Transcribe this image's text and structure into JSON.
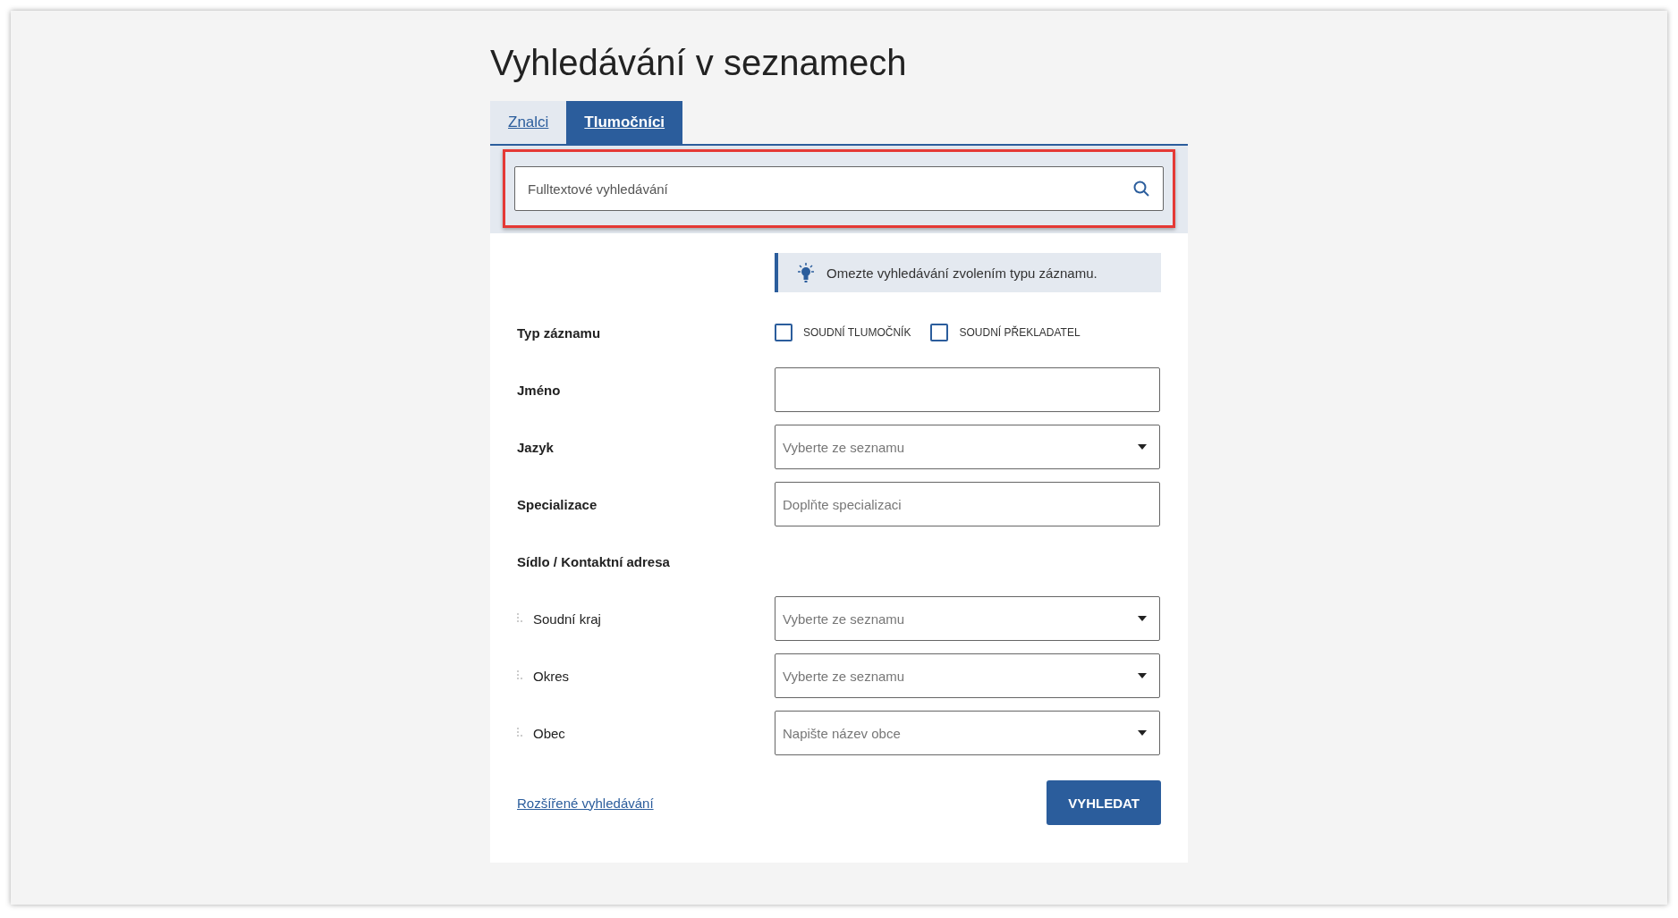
{
  "title": "Vyhledávání v seznamech",
  "tabs": [
    {
      "label": "Znalci",
      "selected": false
    },
    {
      "label": "Tlumočníci",
      "selected": true
    }
  ],
  "search": {
    "placeholder": "Fulltextové vyhledávání",
    "highlighted": true
  },
  "hint": "Omezte vyhledávání zvolením typu záznamu.",
  "fields": [
    {
      "kind": "checkboxes",
      "label": "Typ záznamu",
      "options": [
        {
          "label": "SOUDNÍ TLUMOČNÍK",
          "checked": false
        },
        {
          "label": "SOUDNÍ PŘEKLADATEL",
          "checked": false
        }
      ]
    },
    {
      "kind": "text",
      "label": "Jméno"
    },
    {
      "kind": "select",
      "label": "Jazyk",
      "placeholder": "Vyberte ze seznamu"
    },
    {
      "kind": "text",
      "label": "Specializace",
      "placeholder": "Doplňte specializaci"
    },
    {
      "kind": "heading",
      "label": "Sídlo / Kontaktní adresa"
    },
    {
      "kind": "select",
      "label": "Soudní kraj",
      "placeholder": "Vyberte ze seznamu",
      "sub": true
    },
    {
      "kind": "select",
      "label": "Okres",
      "placeholder": "Vyberte ze seznamu",
      "sub": true
    },
    {
      "kind": "select",
      "label": "Obec",
      "placeholder": "Napište název obce",
      "sub": true
    }
  ],
  "advanced_link": "Rozšířené vyhledávání",
  "submit": "VYHLEDAT"
}
